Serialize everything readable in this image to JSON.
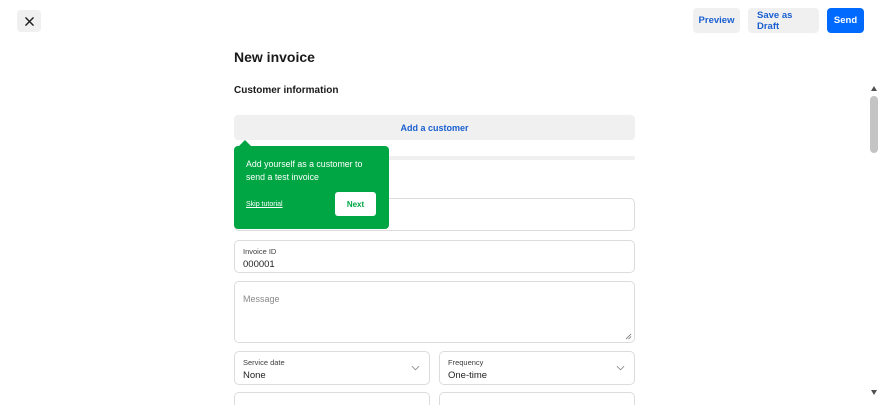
{
  "header": {
    "close_icon": "close-icon",
    "preview_label": "Preview",
    "save_draft_label": "Save as Draft",
    "send_label": "Send"
  },
  "main": {
    "title": "New invoice",
    "customer_section_title": "Customer information",
    "add_customer_label": "Add a customer"
  },
  "tooltip": {
    "text": "Add yourself as a customer to send a test invoice",
    "skip_label": "Skip tutorial",
    "next_label": "Next"
  },
  "fields": {
    "invoice_id": {
      "label": "Invoice ID",
      "value": "000001"
    },
    "message": {
      "placeholder": "Message"
    },
    "service_date": {
      "label": "Service date",
      "value": "None"
    },
    "frequency": {
      "label": "Frequency",
      "value": "One-time"
    }
  },
  "colors": {
    "accent_blue": "#006aff",
    "link_blue": "#1a5fd1",
    "tooltip_green": "#00a544",
    "button_gray": "#f0f0f0"
  }
}
